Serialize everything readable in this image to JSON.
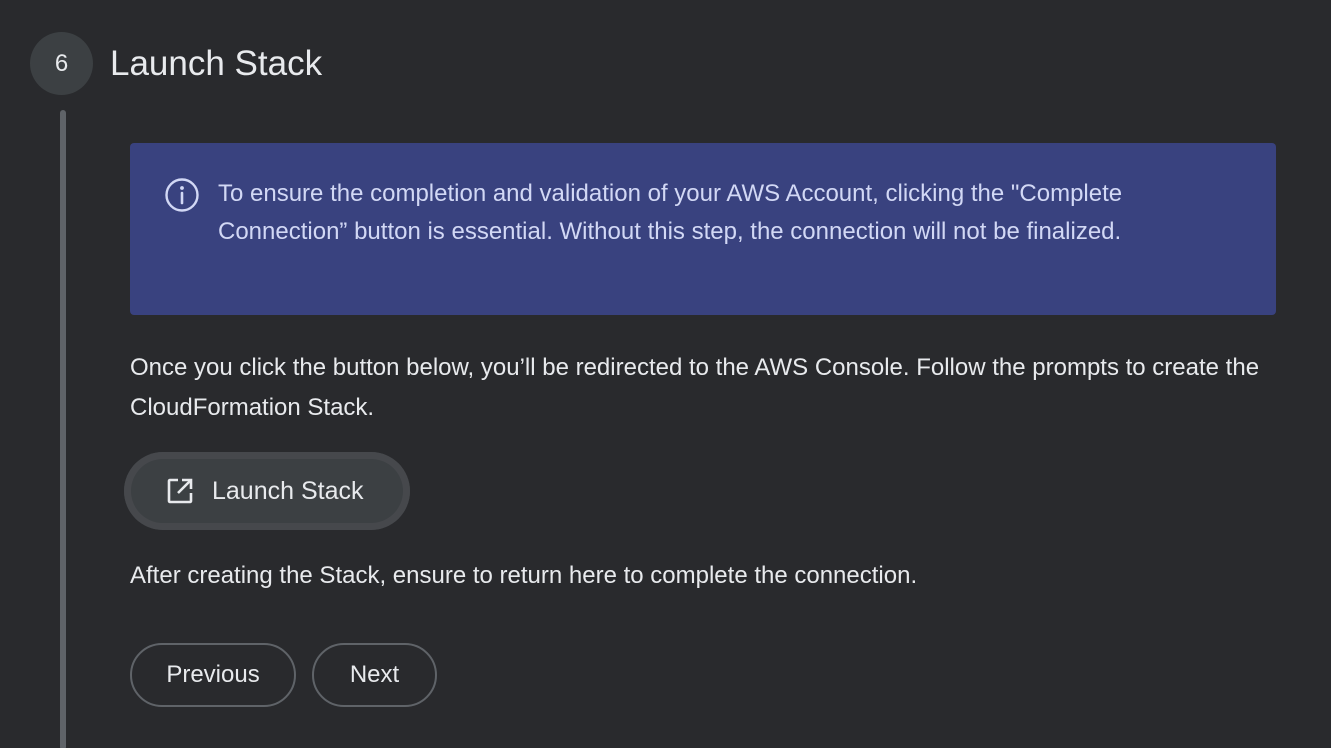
{
  "step": {
    "number": "6",
    "title": "Launch Stack"
  },
  "info_banner": {
    "icon": "info-icon",
    "text": "To ensure the completion and validation of your AWS Account, clicking the \"Complete Connection” button is essential. Without this step, the connection will not be finalized."
  },
  "intro": {
    "text": "Once you click the button below, you’ll be redirected to the AWS Console. Follow the prompts to create the CloudFormation Stack."
  },
  "launch_button": {
    "icon": "open-in-new-icon",
    "label": "Launch Stack"
  },
  "after": {
    "text": "After creating the Stack, ensure to return here to complete the connection."
  },
  "navigation": {
    "previous_label": "Previous",
    "next_label": "Next"
  },
  "colors": {
    "background": "#292a2d",
    "banner": "#39427f",
    "banner_text": "#d2d8f5",
    "text": "#e8eaed",
    "step_line": "#5f6368"
  }
}
